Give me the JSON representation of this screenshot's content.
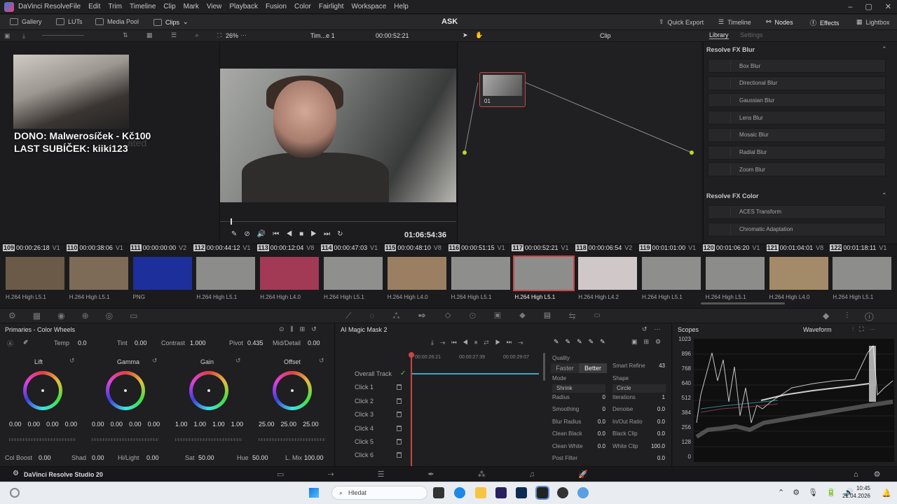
{
  "titlebar": {
    "app_title": "DaVinci Resolve",
    "menus": [
      "File",
      "Edit",
      "Trim",
      "Timeline",
      "Clip",
      "Mark",
      "View",
      "Playback",
      "Fusion",
      "Color",
      "Fairlight",
      "Workspace",
      "Help"
    ],
    "minimize": "–",
    "maximize": "▢",
    "close": "✕"
  },
  "toolbar": {
    "gallery": "Gallery",
    "luts": "LUTs",
    "media_pool": "Media Pool",
    "clips": "Clips",
    "project_title": "ASK",
    "quick_export": "Quick Export",
    "timeline": "Timeline",
    "nodes": "Nodes",
    "effects": "Effects",
    "lightbox": "Lightbox"
  },
  "viewerbar": {
    "zoom": "26%",
    "timeline_name": "Tim...e 1",
    "timecode": "00:00:52:21",
    "clip_mode": "Clip",
    "library_tab": "Library",
    "settings_tab": "Settings"
  },
  "media": {
    "overlay_line1": "DONO: Malwerosíček - Kč100",
    "overlay_line2": "LAST SUBÍČEK: kiiki123",
    "faded_text": "ated"
  },
  "viewer": {
    "timecode": "01:06:54:36"
  },
  "node": {
    "label": "01"
  },
  "library": {
    "sections": [
      {
        "title": "Resolve FX Blur",
        "items": [
          "Box Blur",
          "Directional Blur",
          "Gaussian Blur",
          "Lens Blur",
          "Mosaic Blur",
          "Radial Blur",
          "Zoom Blur"
        ]
      },
      {
        "title": "Resolve FX Color",
        "items": [
          "ACES Transform",
          "Chromatic Adaptation"
        ]
      }
    ]
  },
  "clips": [
    {
      "num": "109",
      "tc": "00:00:26:18",
      "track": "V1",
      "codec": "H.264 High L5.1",
      "color": "#6b5a48"
    },
    {
      "num": "110",
      "tc": "00:00:38:06",
      "track": "V1",
      "codec": "H.264 High L5.1",
      "color": "#7d6b58"
    },
    {
      "num": "111",
      "tc": "00:00:00:00",
      "track": "V2",
      "codec": "PNG",
      "color": "#1d2f9a"
    },
    {
      "num": "112",
      "tc": "00:00:44:12",
      "track": "V1",
      "codec": "H.264 High L5.1",
      "color": "#8c8d8b"
    },
    {
      "num": "113",
      "tc": "00:00:12:04",
      "track": "V8",
      "codec": "H.264 High L4.0",
      "color": "#a23a55"
    },
    {
      "num": "114",
      "tc": "00:00:47:03",
      "track": "V1",
      "codec": "H.264 High L5.1",
      "color": "#8f908e"
    },
    {
      "num": "115",
      "tc": "00:00:48:10",
      "track": "V8",
      "codec": "H.264 High L4.0",
      "color": "#9a7f63"
    },
    {
      "num": "116",
      "tc": "00:00:51:15",
      "track": "V1",
      "codec": "H.264 High L5.1",
      "color": "#8e8f8d"
    },
    {
      "num": "117",
      "tc": "00:00:52:21",
      "track": "V1",
      "codec": "H.264 High L5.1",
      "color": "#8d8e8c"
    },
    {
      "num": "118",
      "tc": "00:00:06:54",
      "track": "V2",
      "codec": "H.264 High L4.2",
      "color": "#d0c8c8"
    },
    {
      "num": "119",
      "tc": "00:01:01:00",
      "track": "V1",
      "codec": "H.264 High L5.1",
      "color": "#8e8f8d"
    },
    {
      "num": "120",
      "tc": "00:01:06:20",
      "track": "V1",
      "codec": "H.264 High L5.1",
      "color": "#8c8d8b"
    },
    {
      "num": "121",
      "tc": "00:01:04:01",
      "track": "V8",
      "codec": "H.264 High L4.0",
      "color": "#a38a68"
    },
    {
      "num": "122",
      "tc": "00:01:18:11",
      "track": "V1",
      "codec": "H.264 High L5.1",
      "color": "#8d8e8c"
    }
  ],
  "primaries": {
    "title": "Primaries - Color Wheels",
    "temp_label": "Temp",
    "temp": "0.0",
    "tint_label": "Tint",
    "tint": "0.00",
    "contrast_label": "Contrast",
    "contrast": "1.000",
    "pivot_label": "Pivot",
    "pivot": "0.435",
    "middetail_label": "Mid/Detail",
    "middetail": "0.00",
    "wheels": [
      {
        "name": "Lift",
        "values": [
          "0.00",
          "0.00",
          "0.00",
          "0.00"
        ]
      },
      {
        "name": "Gamma",
        "values": [
          "0.00",
          "0.00",
          "0.00",
          "0.00"
        ]
      },
      {
        "name": "Gain",
        "values": [
          "1.00",
          "1.00",
          "1.00",
          "1.00"
        ]
      },
      {
        "name": "Offset",
        "values": [
          "25.00",
          "25.00",
          "25.00"
        ]
      }
    ],
    "colboost_label": "Col Boost",
    "colboost": "0.00",
    "shad_label": "Shad",
    "shad": "0.00",
    "hilight_label": "Hi/Light",
    "hilight": "0.00",
    "sat_label": "Sat",
    "sat": "50.00",
    "hue_label": "Hue",
    "hue": "50.00",
    "lmix_label": "L. Mix",
    "lmix": "100.00"
  },
  "magicmask": {
    "title": "AI Magic Mask 2",
    "ruler": [
      "00:00:26:21",
      "00:00:27:39",
      "00:00:29:07"
    ],
    "rows": [
      "Overall Track",
      "Click 1",
      "Click 2",
      "Click 3",
      "Click 4",
      "Click 5",
      "Click 6"
    ],
    "quality_label": "Quality",
    "faster": "Faster",
    "better": "Better",
    "smart_refine_label": "Smart Refine",
    "smart_refine": "43",
    "mode_label": "Mode",
    "mode": "Shrink",
    "shape_label": "Shape",
    "shape": "Circle",
    "props": [
      {
        "l": "Radius",
        "v": "0",
        "l2": "Iterations",
        "v2": "1"
      },
      {
        "l": "Smoothing",
        "v": "0",
        "l2": "Denoise",
        "v2": "0.0"
      },
      {
        "l": "Blur Radius",
        "v": "0.0",
        "l2": "In/Out Ratio",
        "v2": "0.0"
      },
      {
        "l": "Clean Black",
        "v": "0.0",
        "l2": "Black Clip",
        "v2": "0.0"
      },
      {
        "l": "Clean White",
        "v": "0.0",
        "l2": "White Clip",
        "v2": "100.0"
      },
      {
        "l": "Post Filter",
        "v": "",
        "l2": "",
        "v2": "0.0"
      }
    ]
  },
  "scopes": {
    "title": "Scopes",
    "mode": "Waveform",
    "ticks": [
      "1023",
      "896",
      "768",
      "640",
      "512",
      "384",
      "256",
      "128",
      "0"
    ]
  },
  "pagenav": {
    "app_name": "DaVinci Resolve Studio 20"
  },
  "taskbar": {
    "search_placeholder": "Hledat",
    "time": "10:45",
    "date": "21.04.2026"
  }
}
